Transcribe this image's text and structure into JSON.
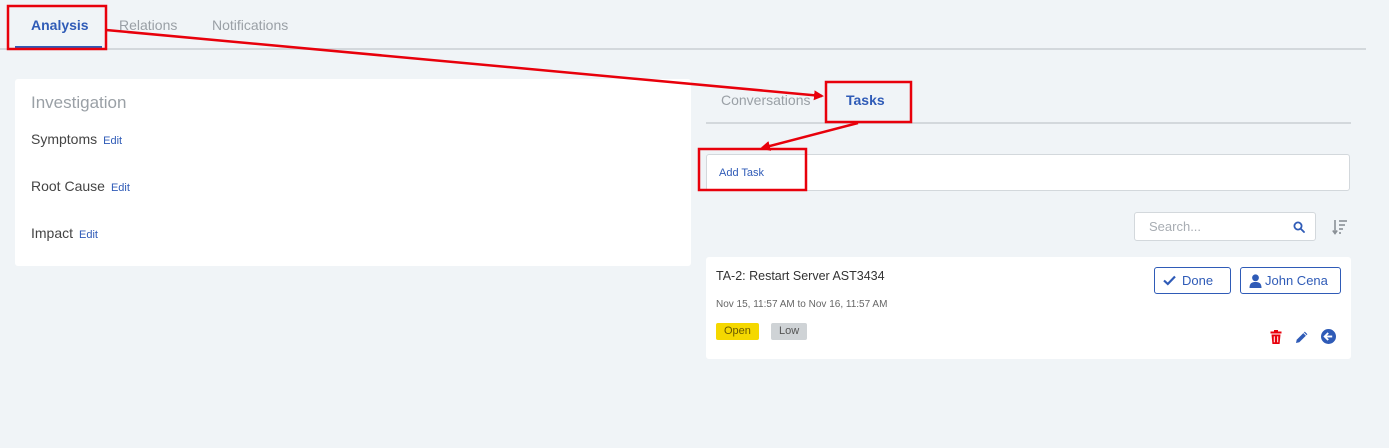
{
  "top_tabs": [
    {
      "label": "Analysis",
      "active": true
    },
    {
      "label": "Relations",
      "active": false
    },
    {
      "label": "Notifications",
      "active": false
    }
  ],
  "investigation": {
    "title": "Investigation",
    "rows": [
      {
        "label": "Symptoms",
        "edit": "Edit"
      },
      {
        "label": "Root Cause",
        "edit": "Edit"
      },
      {
        "label": "Impact",
        "edit": "Edit"
      }
    ]
  },
  "right_tabs": [
    {
      "label": "Conversations",
      "active": false
    },
    {
      "label": "Tasks",
      "active": true
    }
  ],
  "add_task": {
    "label": "Add Task"
  },
  "search": {
    "placeholder": "Search..."
  },
  "task": {
    "title": "TA-2: Restart Server AST3434",
    "dates": "Nov 15, 11:57 AM to Nov 16, 11:57 AM",
    "status": "Open",
    "priority": "Low",
    "done_label": "Done",
    "assignee": "John Cena"
  },
  "colors": {
    "accent": "#2f5bb7",
    "annotation": "#e8000b",
    "status_open": "#f5d800",
    "priority_low": "#cfd3d6",
    "delete": "#e8000b"
  }
}
